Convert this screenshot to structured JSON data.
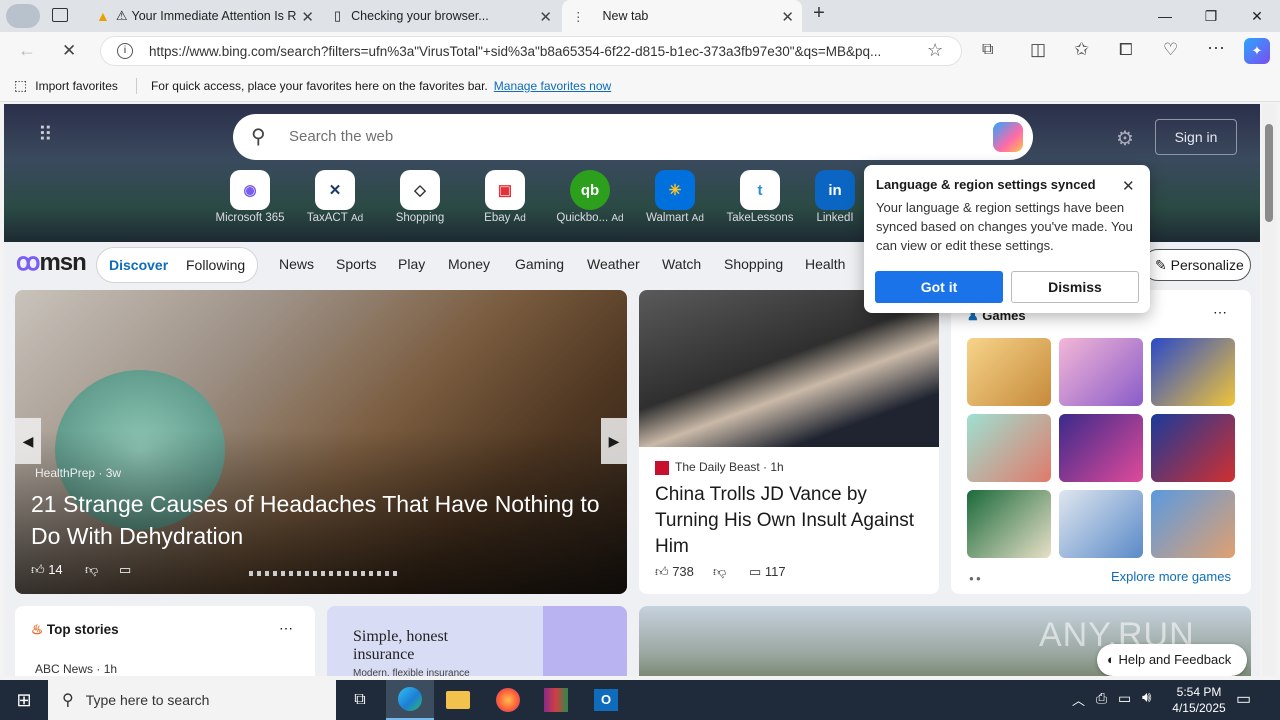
{
  "browser": {
    "tabs": [
      {
        "title": "Your Immediate Attention Is R"
      },
      {
        "title": "Checking your browser..."
      },
      {
        "title": "New tab"
      }
    ],
    "new_tab": "+",
    "url": "https://www.bing.com/search?filters=ufn%3a\"VirusTotal\"+sid%3a\"b8a65354-6f22-d815-b1ec-373a3fb97e30\"&qs=MB&pq...",
    "favorites_bar": {
      "import": "Import favorites",
      "hint": "For quick access, place your favorites here on the favorites bar.",
      "manage_link": "Manage favorites now"
    }
  },
  "msn": {
    "search_placeholder": "Search the web",
    "sign_in": "Sign in",
    "quick_links": [
      {
        "label": "Microsoft 365",
        "ad": false,
        "glyph": "◉"
      },
      {
        "label": "TaxACT",
        "ad": true,
        "glyph": "✕"
      },
      {
        "label": "Shopping",
        "ad": false,
        "glyph": "◇"
      },
      {
        "label": "Ebay",
        "ad": true,
        "glyph": "▣"
      },
      {
        "label": "Quickbo...",
        "ad": true,
        "glyph": "qb"
      },
      {
        "label": "Walmart",
        "ad": true,
        "glyph": "✳"
      },
      {
        "label": "TakeLessons",
        "ad": false,
        "glyph": "t"
      },
      {
        "label": "LinkedI",
        "ad": false,
        "glyph": "in"
      }
    ],
    "ad_tag": "Ad",
    "logo": "msn",
    "pills": [
      "Discover",
      "Following"
    ],
    "nav": [
      "News",
      "Sports",
      "Play",
      "Money",
      "Gaming",
      "Weather",
      "Watch",
      "Shopping",
      "Health"
    ],
    "personalize": "Personalize",
    "hero_story": {
      "source": "HealthPrep",
      "age": "3w",
      "headline": "21 Strange Causes of Headaches That Have Nothing to Do With Dehydration",
      "likes": "14"
    },
    "side_story": {
      "source": "The Daily Beast",
      "age": "1h",
      "headline": "China Trolls JD Vance by Turning His Own Insult Against Him",
      "likes": "738",
      "comments": "117"
    },
    "games": {
      "title": "Games",
      "more": "Explore more games"
    },
    "top_stories": {
      "title": "Top stories",
      "first_source": "ABC News",
      "first_age": "1h"
    },
    "ad_card": {
      "headline": "Simple, honest insurance",
      "sub": "Modern, flexible insurance"
    },
    "feedback": "Help and Feedback"
  },
  "popup": {
    "title": "Language & region settings synced",
    "body": "Your language & region settings have been synced based on changes you've made. You can view or edit these settings.",
    "got_it": "Got it",
    "dismiss": "Dismiss"
  },
  "taskbar": {
    "search_placeholder": "Type here to search",
    "time": "5:54 PM",
    "date": "4/15/2025"
  },
  "colors": {
    "accent": "#0f6cbd",
    "got_it": "#1a73e8",
    "taskbar": "#1f2b3a"
  },
  "watermark": "ANY.RUN"
}
